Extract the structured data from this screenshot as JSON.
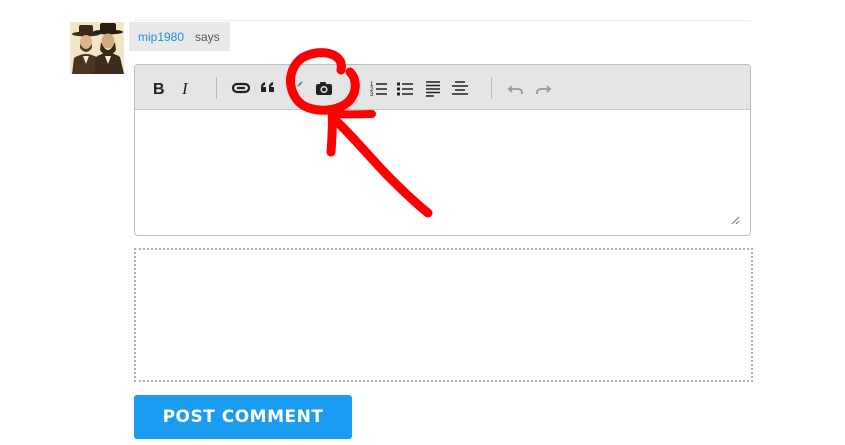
{
  "comment": {
    "author": "mip1980",
    "says": "says"
  },
  "editor": {
    "toolbar": [
      {
        "name": "bold-button",
        "icon": "bold-icon"
      },
      {
        "name": "italic-button",
        "icon": "italic-icon"
      },
      {
        "name": "link-button",
        "icon": "link-icon"
      },
      {
        "name": "blockquote-button",
        "icon": "quote-icon"
      },
      {
        "name": "unlink-button",
        "icon": "unlink-icon"
      },
      {
        "name": "image-button",
        "icon": "camera-icon"
      },
      {
        "name": "ordered-list-button",
        "icon": "numbered-list-icon"
      },
      {
        "name": "bullet-list-button",
        "icon": "bullet-list-icon"
      },
      {
        "name": "align-left-button",
        "icon": "align-left-icon"
      },
      {
        "name": "align-center-button",
        "icon": "align-center-icon"
      },
      {
        "name": "undo-button",
        "icon": "undo-icon"
      },
      {
        "name": "redo-button",
        "icon": "redo-icon"
      }
    ]
  },
  "actions": {
    "post_label": "POST COMMENT"
  },
  "annotation": {
    "color": "#ff0000",
    "target": "camera-icon"
  },
  "colors": {
    "link": "#1a8fd8",
    "button": "#1a9cf0",
    "toolbar_bg": "#e5e5e5"
  }
}
